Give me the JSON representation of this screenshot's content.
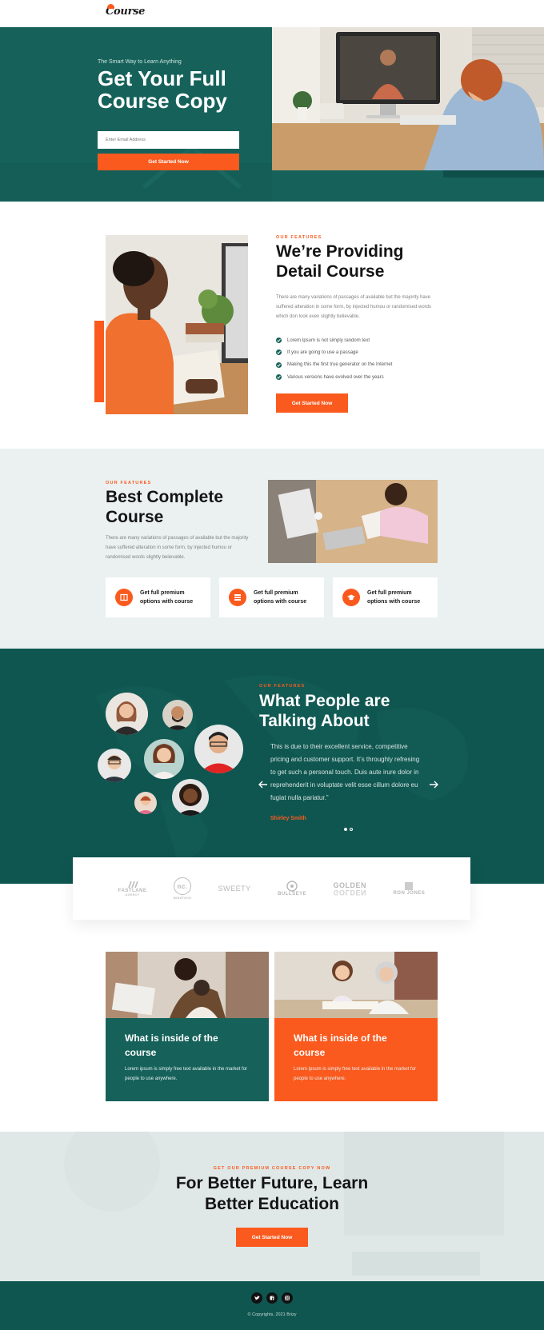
{
  "header": {
    "logo_text": "Course"
  },
  "hero": {
    "tagline": "The Smart Way to Learn Anything",
    "title": "Get Your Full Course Copy",
    "email_placeholder": "Enter Email Address",
    "cta_label": "Get Started Now"
  },
  "features_detail": {
    "eyebrow": "OUR FEATURES",
    "title": "We’re Providing Detail Course",
    "description": "There are many variations of passages of available but the majority have suffered alteration in some form, by injected humou or randomised words which don look even slightly believable.",
    "checklist": [
      "Lorem Ipsum is not simply random text",
      "If you are going to use a passage",
      "Making this the first true generator on the Internet",
      "Various versions have evolved over the years"
    ],
    "cta_label": "Get Started Now"
  },
  "features_complete": {
    "eyebrow": "OUR FEATURES",
    "title": "Best Complete Course",
    "description": "There are many variations of passages of available but the majority have suffered alteration in some form, by injected humou or randomised words slightly believable.",
    "cards": [
      {
        "icon": "book-icon",
        "label": "Get full premium options with course"
      },
      {
        "icon": "grid-icon",
        "label": "Get full premium options with course"
      },
      {
        "icon": "graduation-cap-icon",
        "label": "Get full premium options with course"
      }
    ]
  },
  "testimonials": {
    "eyebrow": "OUR FEATURES",
    "title": "What People are Talking About",
    "quote": "This is due to their excellent service, competitive pricing and customer support. It’s throughly refresing to get such a personal touch. Duis aute irure dolor in reprehenderit in voluptate velit esse cillum dolore eu fugiat nulla pariatur.”",
    "author": "Shirley Smith"
  },
  "partners": [
    {
      "name": "FASTLANE",
      "sub": "AGENCY"
    },
    {
      "name": "nc.",
      "sub": "MINDTECH"
    },
    {
      "name": "SWEETY",
      "sub": ""
    },
    {
      "name": "BULLSEYE",
      "sub": ""
    },
    {
      "name": "GOLDEN",
      "sub": "GOLDEN"
    },
    {
      "name": "RON JONES",
      "sub": ""
    }
  ],
  "course_cards": [
    {
      "title": "What is inside of the course",
      "text": "Lorem ipsum is simply free text available in the market for people to use anywhere."
    },
    {
      "title": "What is inside of the course",
      "text": "Lorem ipsum is simply free text available in the market for people to use anywhere."
    }
  ],
  "cta": {
    "eyebrow": "GET OUR PREMIUM COURSE COPY NOW",
    "title": "For Better Future, Learn Better Education",
    "cta_label": "Get Started Now"
  },
  "footer": {
    "social": [
      "twitter-icon",
      "facebook-icon",
      "instagram-icon"
    ],
    "copyright": "© Copyrights, 2021 Brizy"
  },
  "colors": {
    "accent": "#fa5a1e",
    "teal": "#16625b",
    "dark_teal": "#0f5650",
    "light_bg": "#ebf1f1"
  }
}
